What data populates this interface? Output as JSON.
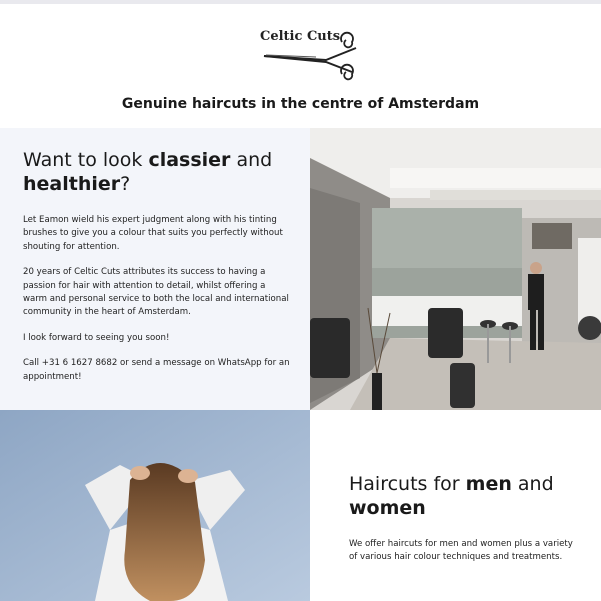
{
  "brand": {
    "logo_text": "Celtic Cuts",
    "logo_icon": "scissors-icon"
  },
  "tagline": "Genuine haircuts in the centre of Amsterdam",
  "section1": {
    "heading_pre": "Want to look ",
    "heading_bold1": "classier",
    "heading_mid": " and ",
    "heading_bold2": "healthier",
    "heading_post": "?",
    "paragraphs": [
      "Let Eamon wield his expert judgment along with his tinting brushes to give you a colour that suits you perfectly without shouting for attention.",
      "20 years of Celtic Cuts attributes its success to having a passion for hair with attention to detail, whilst offering a warm and personal service to both the local and international community in the heart of Amsterdam.",
      "I look forward to seeing you soon!",
      "Call +31 6 1627 8682 or send a message on WhatsApp for an appointment!"
    ],
    "image_name": "salon-interior-photo"
  },
  "section2": {
    "heading_pre": "Haircuts for ",
    "heading_bold1": "men",
    "heading_mid": " and ",
    "heading_bold2": "women",
    "paragraph": "We offer haircuts for men and women plus a variety of various hair colour techniques and treatments.",
    "image_name": "woman-hair-photo"
  },
  "colors": {
    "panel_bg": "#f3f5fa",
    "text": "#1a1a1a"
  }
}
